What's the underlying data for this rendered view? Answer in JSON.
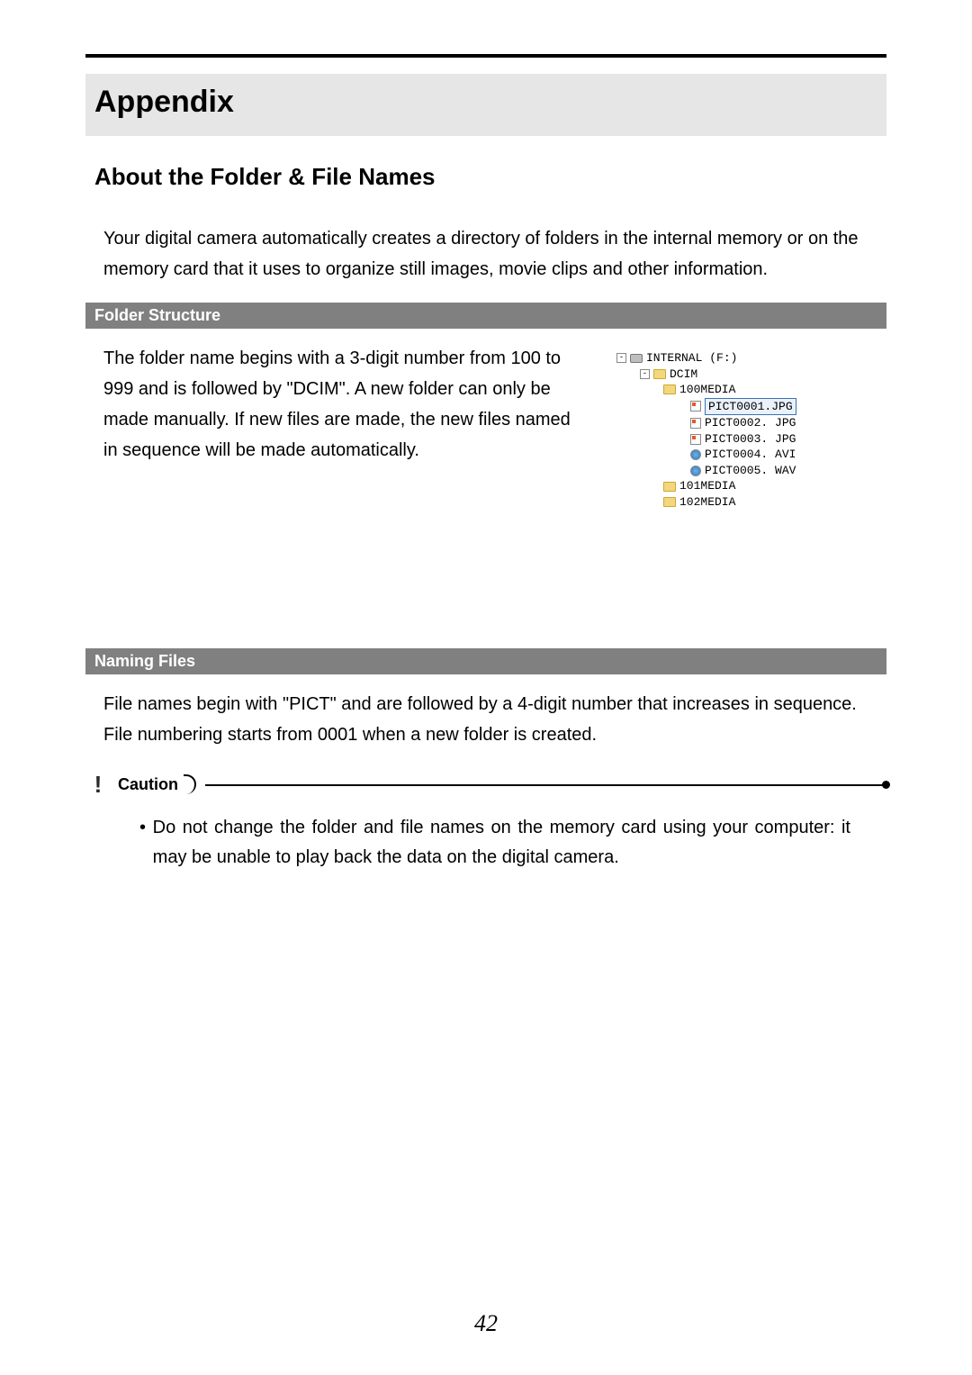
{
  "page": {
    "title": "Appendix",
    "section": "About the Folder & File Names",
    "intro": "Your digital camera automatically creates a directory of folders in the internal memory or on the memory card that it uses to organize still images, movie clips and other information.",
    "page_number": "42"
  },
  "folder_structure": {
    "heading": "Folder Structure",
    "body": "The folder name begins with a 3-digit number from 100 to 999 and is followed by \"DCIM\". A new folder can only be made manually. If new files are made, the new files named in sequence will be made automatically.",
    "tree": {
      "drive": "INTERNAL (F:)",
      "root": "DCIM",
      "folders": [
        {
          "name": "100MEDIA",
          "files": [
            {
              "name": "PICT0001.JPG",
              "type": "img",
              "selected": true
            },
            {
              "name": "PICT0002. JPG",
              "type": "img"
            },
            {
              "name": "PICT0003. JPG",
              "type": "img"
            },
            {
              "name": "PICT0004. AVI",
              "type": "media"
            },
            {
              "name": "PICT0005. WAV",
              "type": "media"
            }
          ]
        },
        {
          "name": "101MEDIA"
        },
        {
          "name": "102MEDIA"
        }
      ]
    }
  },
  "naming_files": {
    "heading": "Naming Files",
    "body": "File names begin with \"PICT\" and are followed by a 4-digit number that increases in sequence. File numbering starts from 0001 when a new folder is created."
  },
  "caution": {
    "label": "Caution",
    "bullet": "Do not change the folder and file names on the memory card using your computer: it may be unable to play back the data on the digital camera."
  }
}
